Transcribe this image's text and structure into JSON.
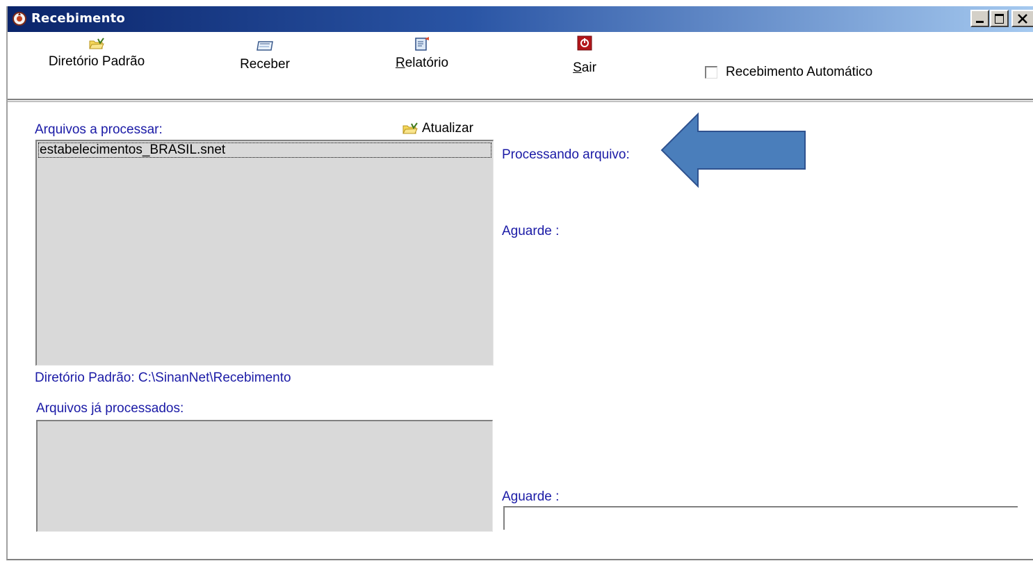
{
  "window": {
    "title": "Recebimento",
    "controls": [
      "minimize-icon",
      "maximize-icon",
      "close-icon"
    ]
  },
  "toolbar": {
    "buttons": [
      {
        "label": "Diretório Padrão",
        "icon": "folder-icon"
      },
      {
        "label": "Receber",
        "icon": "receive-icon"
      },
      {
        "mnemonic": "R",
        "rest": "elatório",
        "icon": "report-icon"
      },
      {
        "mnemonic": "S",
        "rest": "air",
        "icon": "exit-icon"
      }
    ],
    "auto_receive": {
      "label": "Recebimento Automático",
      "checked": false
    }
  },
  "left": {
    "pending_label": "Arquivos a processar:",
    "refresh_label": "Atualizar",
    "pending_files": [
      "estabelecimentos_BRASIL.snet"
    ],
    "default_dir_label": "Diretório Padrão: C:\\SinanNet\\Recebimento",
    "processed_label": "Arquivos já processados:",
    "processed_files": []
  },
  "right": {
    "processing_label": "Processando arquivo:",
    "wait_label_1": "Aguarde :",
    "wait_label_2": "Aguarde :",
    "progress_value": ""
  },
  "colors": {
    "label_blue": "#1a1aa6",
    "arrow_fill": "#4a7ebb",
    "arrow_stroke": "#2f528f",
    "list_bg": "#d9d9d9"
  }
}
